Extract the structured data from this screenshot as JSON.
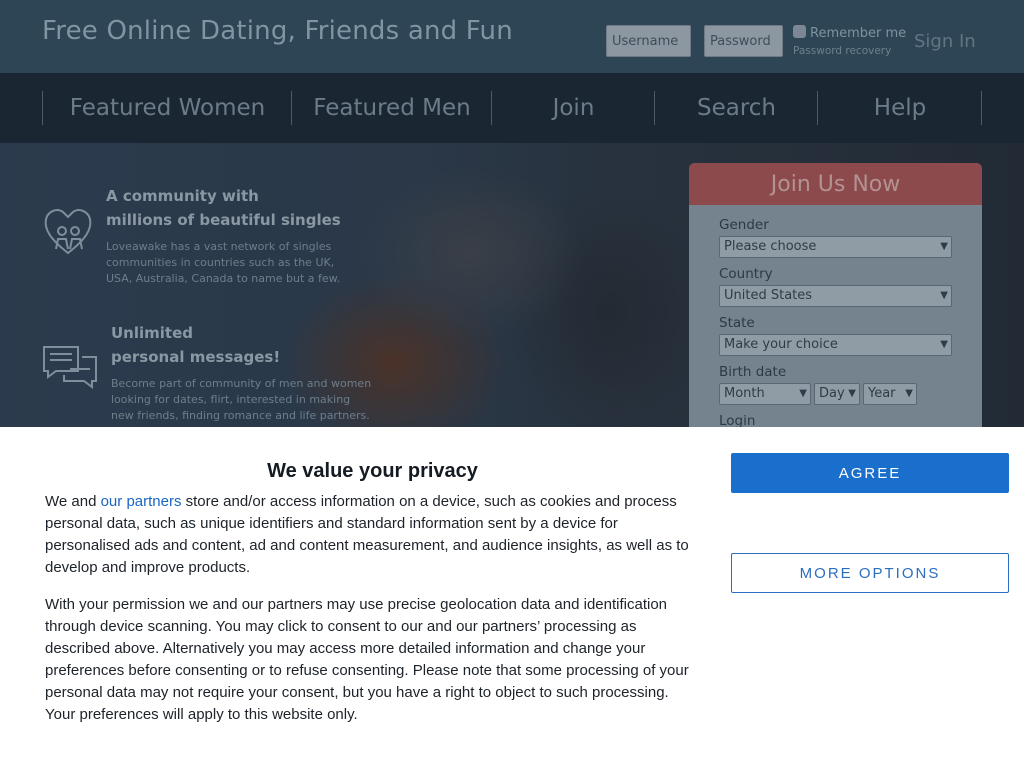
{
  "header": {
    "site_title": "Free Online Dating, Friends and Fun",
    "username_placeholder": "Username",
    "password_placeholder": "Password",
    "remember_label": "Remember me",
    "password_recovery": "Password recovery",
    "signin_label": "Sign In"
  },
  "nav": {
    "items": [
      "Featured Women",
      "Featured Men",
      "Join",
      "Search",
      "Help"
    ]
  },
  "features": [
    {
      "icon": "couple-heart-icon",
      "title_line1": "A community with",
      "title_line2": "millions of beautiful singles",
      "text_line1": "Loveawake has a vast network of singles",
      "text_line2": "communities in countries such as the UK,",
      "text_line3": "USA, Australia, Canada to name but a few."
    },
    {
      "icon": "chat-bubbles-icon",
      "title_line1": "Unlimited",
      "title_line2": "personal messages!",
      "text_line1": "Become part of community of men and women",
      "text_line2": "looking for dates, flirt, interested in making",
      "text_line3": "new friends, finding romance and life partners."
    }
  ],
  "join": {
    "title": "Join Us Now",
    "gender_label": "Gender",
    "gender_value": "Please choose",
    "country_label": "Country",
    "country_value": "United States",
    "state_label": "State",
    "state_value": "Make your choice",
    "birthdate_label": "Birth date",
    "month_value": "Month",
    "day_value": "Day",
    "year_value": "Year",
    "login_label": "Login"
  },
  "privacy": {
    "title": "We value your privacy",
    "p1_before": "We and ",
    "p1_link": "our partners",
    "p1_after": " store and/or access information on a device, such as cookies and process personal data, such as unique identifiers and standard information sent by a device for personalised ads and content, ad and content measurement, and audience insights, as well as to develop and improve products.",
    "p2": "With your permission we and our partners may use precise geolocation data and identification through device scanning. You may click to consent to our and our partners’ processing as described above. Alternatively you may access more detailed information and change your preferences before consenting or to refuse consenting. Please note that some processing of your personal data may not require your consent, but you have a right to object to such processing. Your preferences will apply to this website only.",
    "agree_label": "AGREE",
    "more_options_label": "MORE OPTIONS"
  },
  "colors": {
    "header_bg": "#2e4556",
    "nav_bg": "#1b2633",
    "join_header": "#8c4a4c",
    "agree_button": "#1b6fcc",
    "link": "#1a66c4"
  }
}
